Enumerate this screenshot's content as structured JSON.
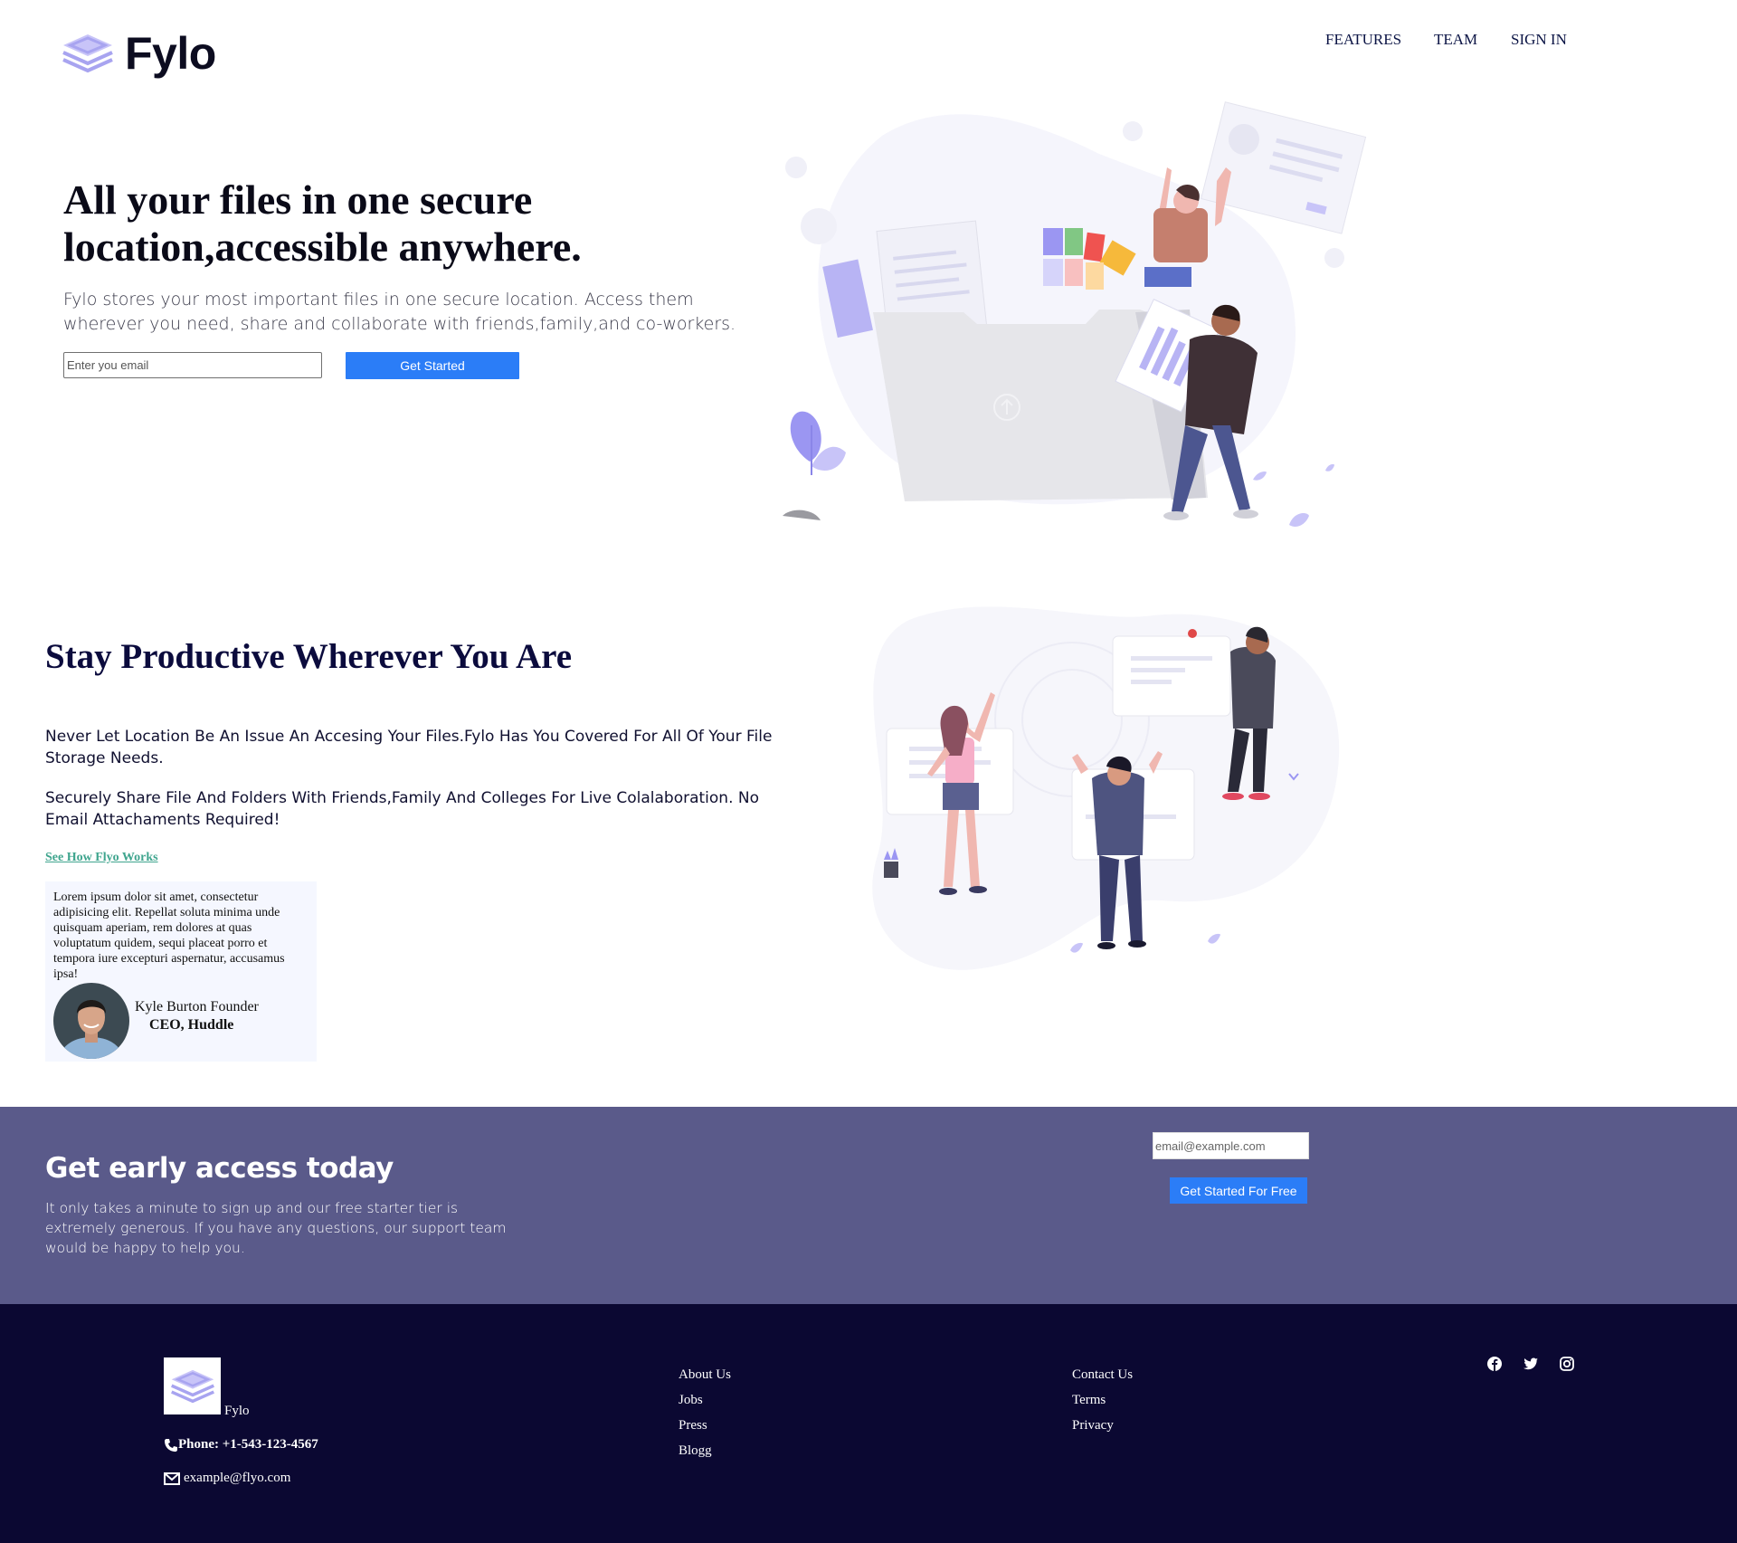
{
  "header": {
    "logo_text": "Fylo",
    "nav": {
      "features": "FEATURES",
      "team": "TEAM",
      "sign_in": "SIGN IN"
    }
  },
  "hero": {
    "title_line1": "All your files in one secure",
    "title_line2": "location,accessible anywhere.",
    "description": "Fylo stores your most important files in one secure location. Access them wherever you need, share and collaborate with friends,family,and co-workers.",
    "email_placeholder": "Enter you email",
    "cta_label": "Get Started"
  },
  "productive": {
    "title": "Stay Productive Wherever You Are",
    "paragraph1": "Never Let Location Be An Issue An Accesing Your Files.Fylo Has You Covered For All Of Your File Storage Needs.",
    "paragraph2": "Securely Share File And Folders With Friends,Family And Colleges For Live Colalaboration. No Email Attachaments Required!",
    "link_label": "See How Flyo Works",
    "testimonial": {
      "text": "Lorem ipsum dolor sit amet, consectetur adipisicing elit. Repellat soluta minima unde quisquam aperiam, rem dolores at quas voluptatum quidem, sequi placeat porro et tempora iure excepturi aspernatur, accusamus ipsa!",
      "name": "Kyle Burton Founder",
      "role": "CEO, Huddle"
    }
  },
  "early_access": {
    "title": "Get early access today",
    "text": "It only takes a minute to sign up and our free starter tier is extremely generous. If you have any questions, our support team would be happy to help you.",
    "email_placeholder": "email@example.com",
    "cta_label": "Get Started For Free"
  },
  "footer": {
    "logo_label": "Fylo",
    "phone": "Phone: +1-543-123-4567",
    "email": "example@flyo.com",
    "col1": [
      "About Us",
      "Jobs",
      "Press",
      "Blogg"
    ],
    "col2": [
      "Contact Us",
      "Terms",
      "Privacy"
    ],
    "social_icons": [
      "facebook-icon",
      "twitter-icon",
      "instagram-icon"
    ]
  },
  "colors": {
    "accent_blue": "#2b7df7",
    "band_bg": "#5a5a8a",
    "footer_bg": "#0b0832",
    "link_green": "#3fa58e",
    "logo_purple": "#a8a4f0"
  }
}
